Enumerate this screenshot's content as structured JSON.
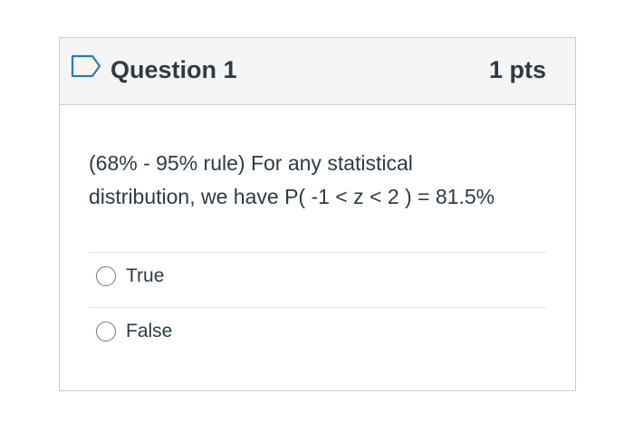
{
  "question": {
    "title": "Question 1",
    "points": "1 pts",
    "text_lines": [
      "(68% - 95% rule) For any statistical",
      "distribution, we have P( -1 < z < 2 ) = 81.5%"
    ],
    "answers": [
      {
        "label": "True",
        "selected": false
      },
      {
        "label": "False",
        "selected": false
      }
    ],
    "flag_icon": "flag-outline-icon"
  },
  "colors": {
    "text": "#2d3b45",
    "header_bg": "#f5f5f5",
    "border": "#c7cdd1",
    "flag": "#2b7abc"
  }
}
